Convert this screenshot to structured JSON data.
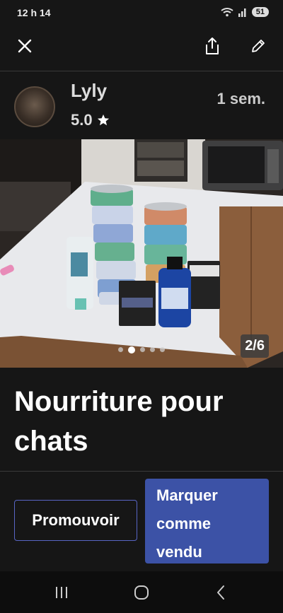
{
  "status_bar": {
    "time": "12 h 14",
    "battery": "51"
  },
  "toolbar": {
    "close_icon": "close-icon",
    "share_icon": "share-icon",
    "edit_icon": "edit-icon"
  },
  "seller": {
    "name": "Lyly",
    "rating": "5.0",
    "posted": "1 sem."
  },
  "gallery": {
    "counter": "2/6",
    "total_dots": 5,
    "active_dot": 1
  },
  "listing": {
    "title": "Nourriture pour chats"
  },
  "actions": {
    "promote_label": "Promouvoir",
    "mark_sold_label": "Marquer comme vendu"
  },
  "colors": {
    "background": "#161616",
    "accent": "#3c52a6",
    "outline": "#5865c4"
  }
}
